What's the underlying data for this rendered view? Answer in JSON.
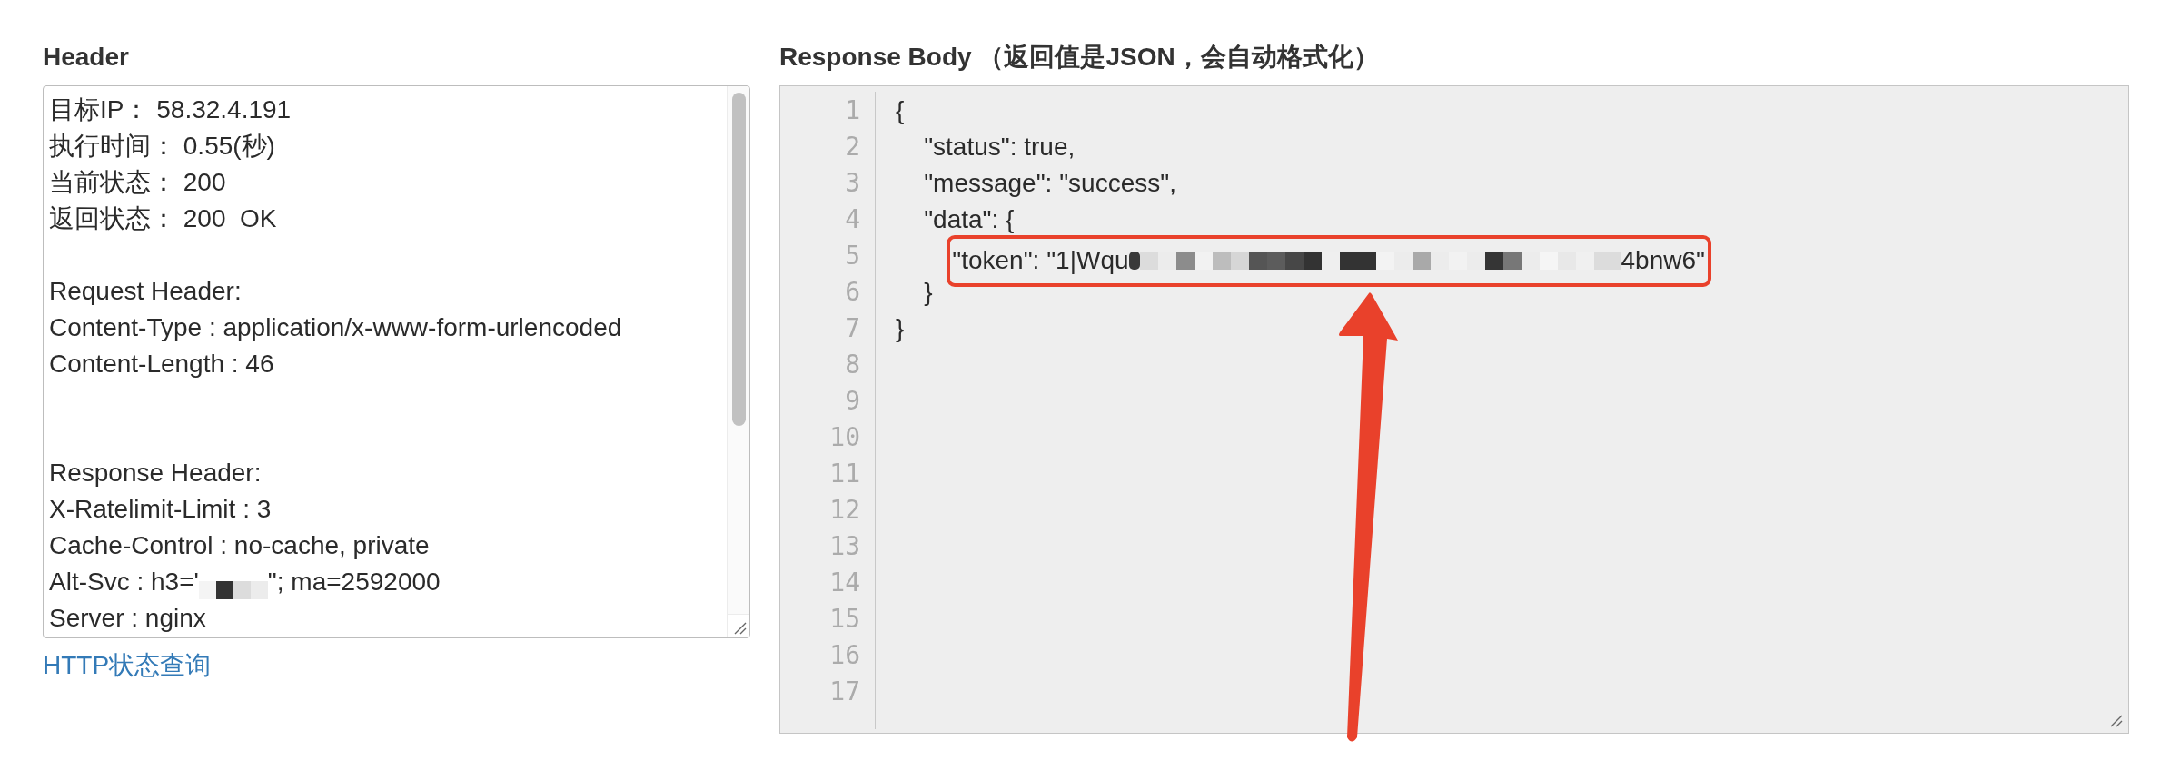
{
  "header_panel": {
    "title": "Header",
    "lines": [
      {
        "kind": "text",
        "text": "目标IP： 58.32.4.191"
      },
      {
        "kind": "text",
        "text": "执行时间： 0.55(秒)"
      },
      {
        "kind": "text",
        "text": "当前状态： 200"
      },
      {
        "kind": "text",
        "text": "返回状态： 200  OK"
      },
      {
        "kind": "blank"
      },
      {
        "kind": "text",
        "text": "Request Header:"
      },
      {
        "kind": "text",
        "text": "Content-Type : application/x-www-form-urlencoded"
      },
      {
        "kind": "text",
        "text": "Content-Length : 46"
      },
      {
        "kind": "blank"
      },
      {
        "kind": "blank"
      },
      {
        "kind": "text",
        "text": "Response Header:"
      },
      {
        "kind": "text",
        "text": "X-Ratelimit-Limit : 3"
      },
      {
        "kind": "text",
        "text": "Cache-Control : no-cache, private"
      },
      {
        "kind": "redacted",
        "before": "Alt-Svc : h3='",
        "after": "\"; ma=2592000"
      },
      {
        "kind": "text",
        "text": "Server : nginx"
      }
    ],
    "link": "HTTP状态查询"
  },
  "response_panel": {
    "title": "Response Body （返回值是JSON，会自动格式化）",
    "lines": [
      {
        "number": "1",
        "kind": "text",
        "text": "{",
        "highlighted": false
      },
      {
        "number": "2",
        "kind": "text",
        "text": "    \"status\": true,",
        "highlighted": false
      },
      {
        "number": "3",
        "kind": "text",
        "text": "    \"message\": \"success\",",
        "highlighted": false
      },
      {
        "number": "4",
        "kind": "text",
        "text": "    \"data\": {",
        "highlighted": false
      },
      {
        "number": "5",
        "kind": "redacted",
        "before": "        \"token\": \"1|Wqu",
        "after": "4bnw6\"",
        "highlighted": true
      },
      {
        "number": "6",
        "kind": "text",
        "text": "    }",
        "highlighted": false
      },
      {
        "number": "7",
        "kind": "text",
        "text": "}",
        "highlighted": false
      },
      {
        "number": "8",
        "kind": "blank",
        "highlighted": false
      },
      {
        "number": "9",
        "kind": "blank",
        "highlighted": false
      },
      {
        "number": "10",
        "kind": "blank",
        "highlighted": false
      },
      {
        "number": "11",
        "kind": "blank",
        "highlighted": false
      },
      {
        "number": "12",
        "kind": "blank",
        "highlighted": false
      },
      {
        "number": "13",
        "kind": "blank",
        "highlighted": false
      },
      {
        "number": "14",
        "kind": "blank",
        "highlighted": false
      },
      {
        "number": "15",
        "kind": "blank",
        "highlighted": false
      },
      {
        "number": "16",
        "kind": "blank",
        "highlighted": false
      },
      {
        "number": "17",
        "kind": "blank",
        "highlighted": false
      }
    ],
    "annotation_arrow": true
  }
}
